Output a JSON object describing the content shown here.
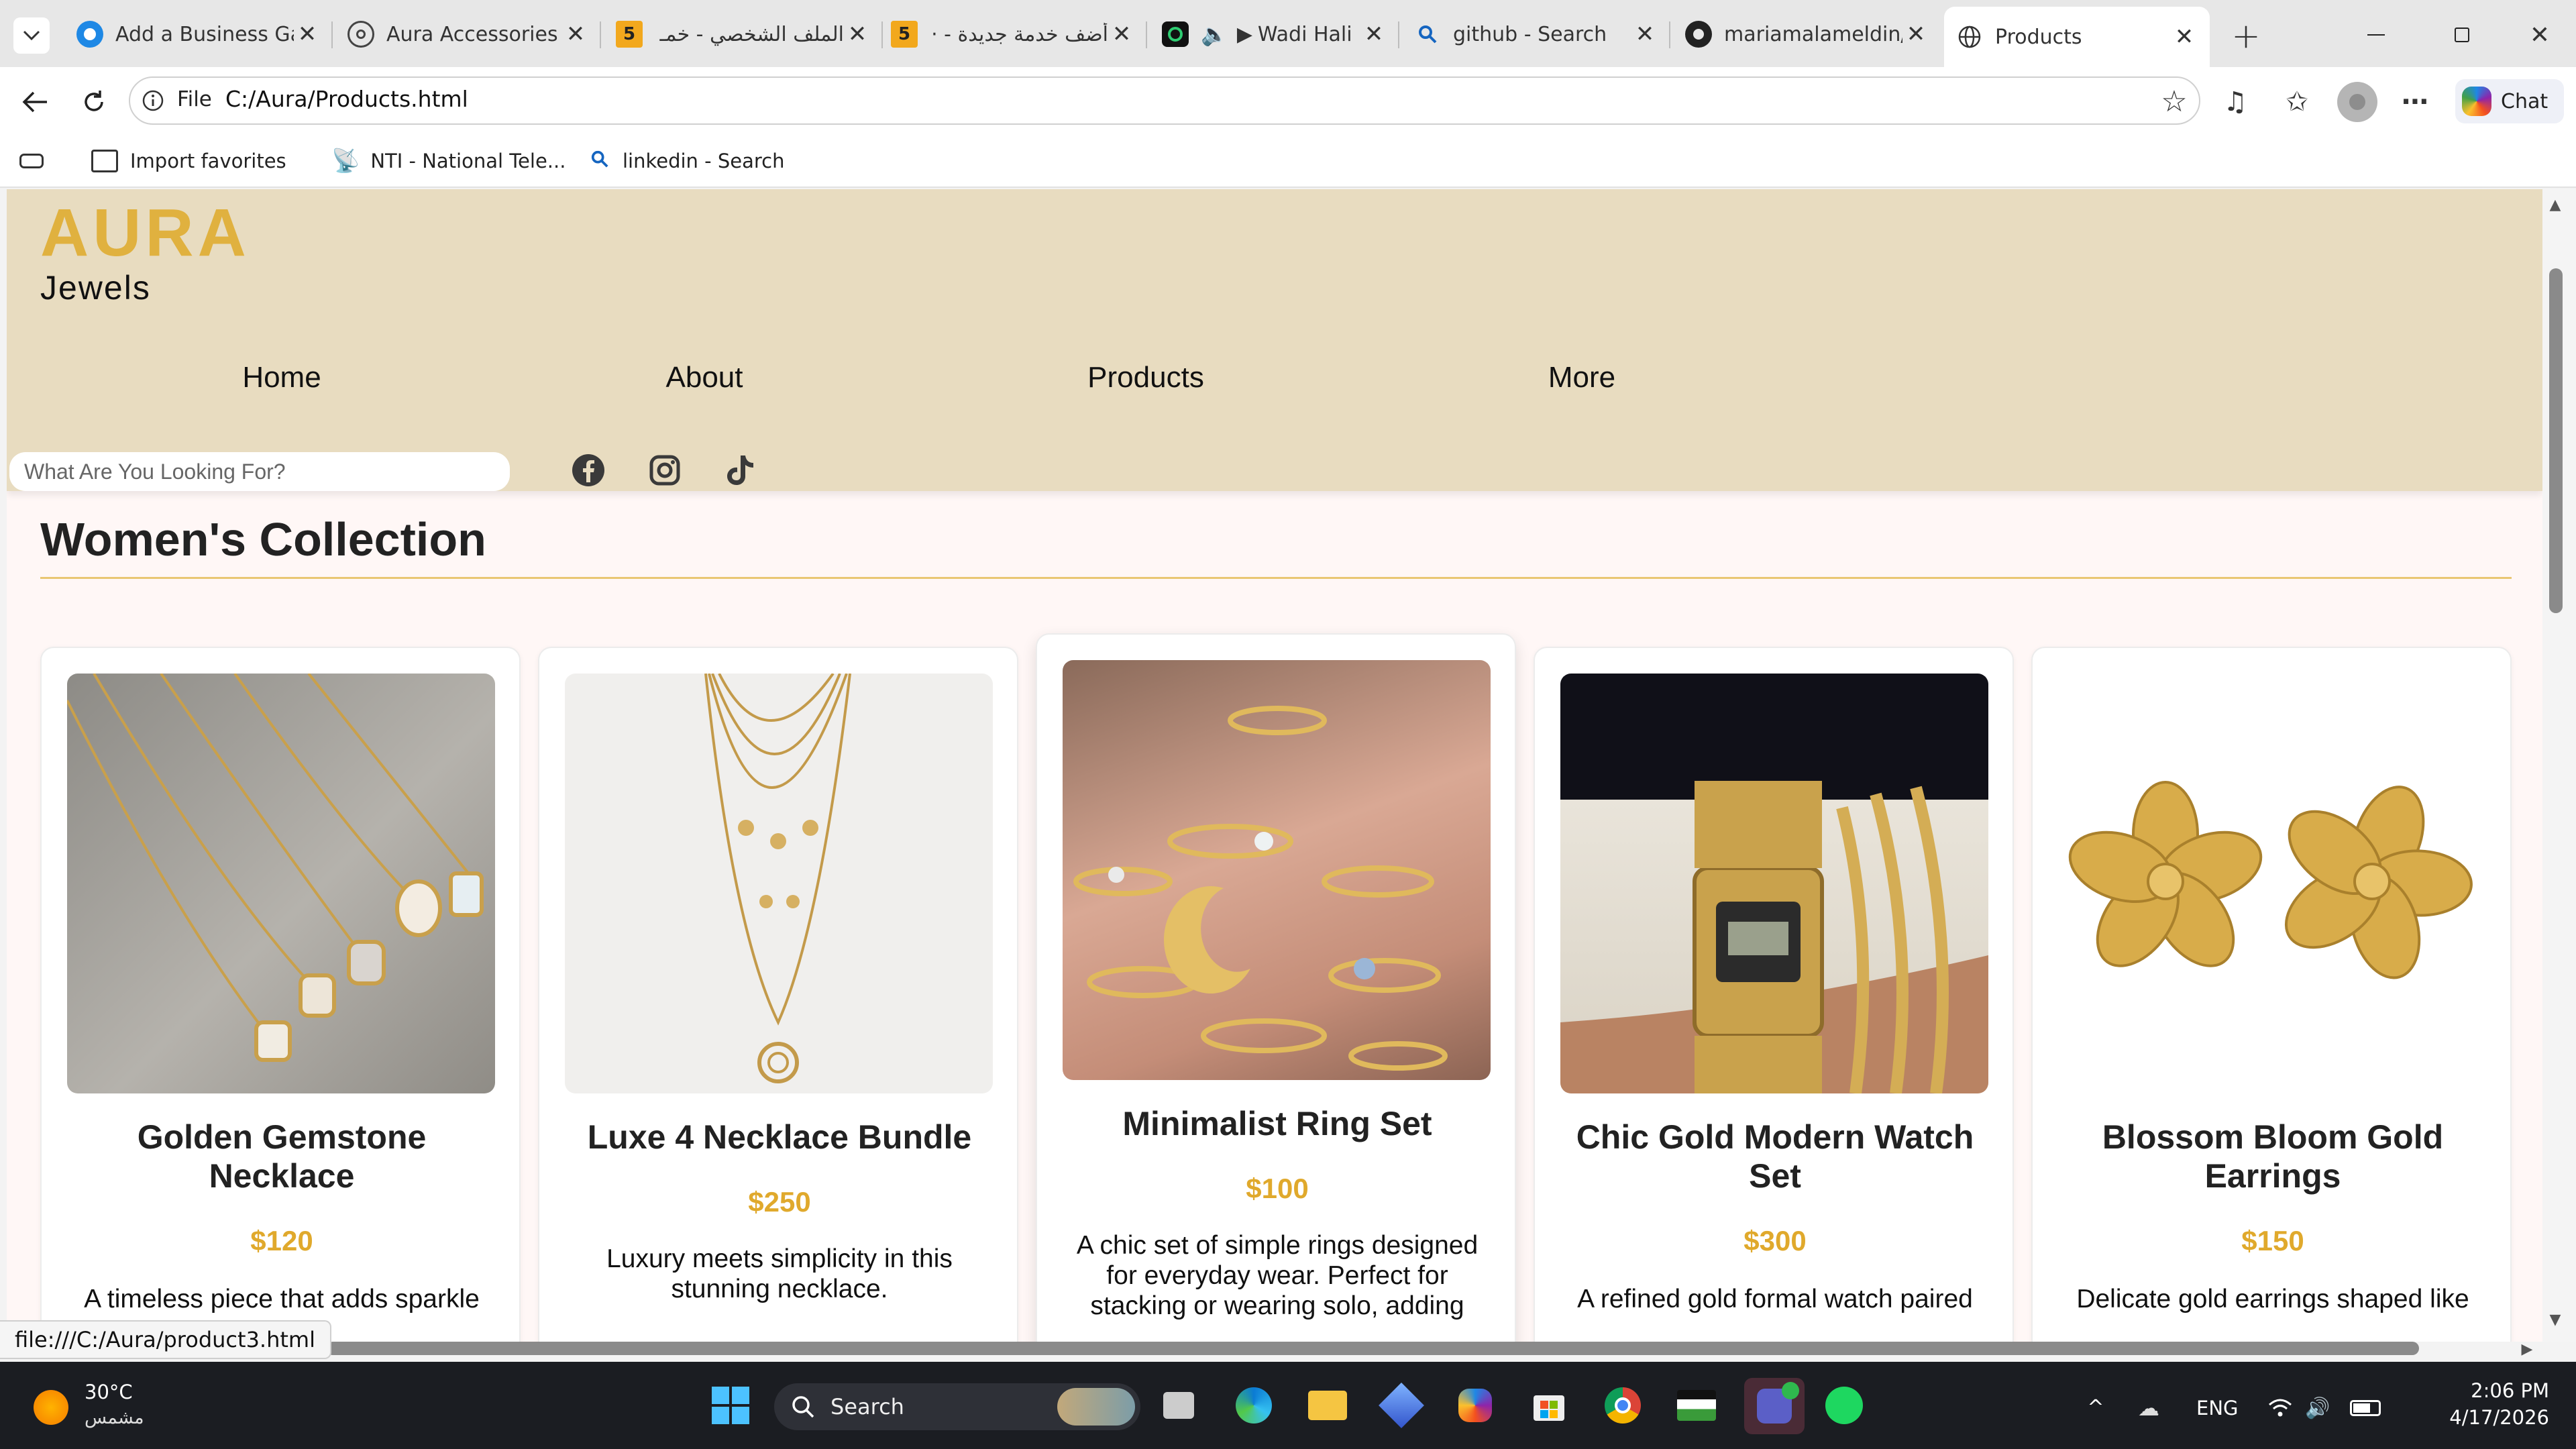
{
  "browser": {
    "tabs": [
      {
        "title": "Add a Business Gall",
        "favicon": "edge-blue-icon"
      },
      {
        "title": "Aura Accessories",
        "favicon": "openai-icon"
      },
      {
        "title": "الملف الشخصي - خمـ",
        "favicon": "five-icon"
      },
      {
        "title": "أضف خدمة جديدة - ·",
        "favicon": "five-icon"
      },
      {
        "title": "Wadi Hali M",
        "favicon": "music-icon"
      },
      {
        "title": "github - Search",
        "favicon": "search-icon"
      },
      {
        "title": "mariamalameldin/A",
        "favicon": "github-icon"
      },
      {
        "title": "Products",
        "favicon": "globe-icon"
      }
    ],
    "five_badge": "5",
    "play_glyph": "▶",
    "address_scheme": "File",
    "address_url": "C:/Aura/Products.html",
    "chat_label": "Chat",
    "favorites": [
      {
        "label": "Import favorites"
      },
      {
        "label": "NTI - National Tele..."
      },
      {
        "label": "linkedin - Search"
      }
    ],
    "status_url": "file:///C:/Aura/product3.html"
  },
  "site": {
    "logo": "AURA",
    "tagline": "Jewels",
    "nav": [
      "Home",
      "About",
      "Products",
      "More"
    ],
    "search_placeholder": "What Are You Looking For?",
    "collection_title": "Women's Collection",
    "products": [
      {
        "name": "Golden Gemstone Necklace",
        "price": "$120",
        "description": "A timeless piece that adds sparkle"
      },
      {
        "name": "Luxe 4 Necklace Bundle",
        "price": "$250",
        "description": "Luxury meets simplicity in this stunning necklace."
      },
      {
        "name": "Minimalist Ring Set",
        "price": "$100",
        "description": "A chic set of simple rings designed for everyday wear. Perfect for stacking or wearing solo, adding"
      },
      {
        "name": "Chic Gold Modern Watch Set",
        "price": "$300",
        "description": "A refined gold formal watch paired"
      },
      {
        "name": "Blossom Bloom Gold Earrings",
        "price": "$150",
        "description": "Delicate gold earrings shaped like"
      }
    ]
  },
  "taskbar": {
    "temperature": "30°C",
    "weather": "مشمس",
    "search_label": "Search",
    "language": "ENG",
    "time": "2:06 PM",
    "date": "4/17/2026"
  },
  "colors": {
    "accent_gold": "#e0b13f",
    "header_bg": "#e8dcc0",
    "page_bg": "#fff7f6"
  }
}
